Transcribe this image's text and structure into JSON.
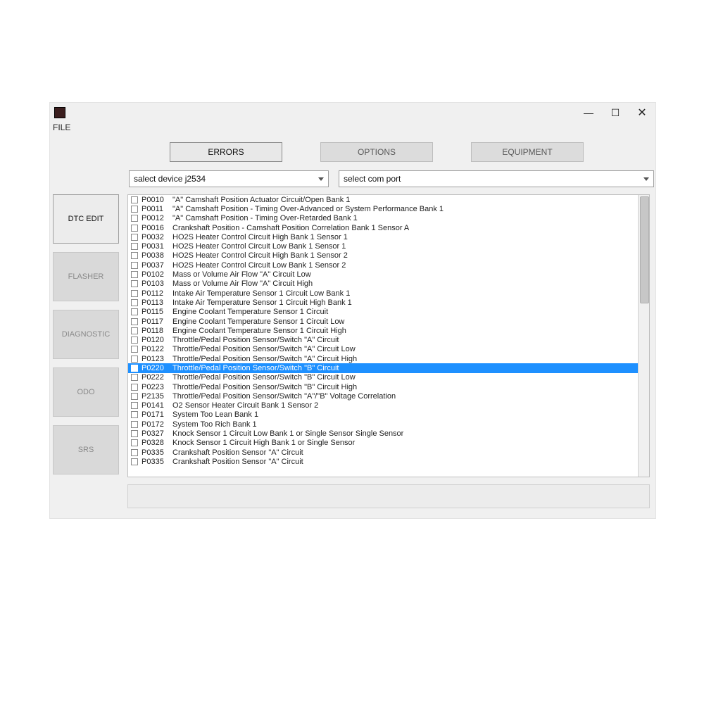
{
  "menu": {
    "file": "FILE"
  },
  "topTabs": {
    "errors": "ERRORS",
    "options": "OPTIONS",
    "equipment": "EQUIPMENT"
  },
  "activeTopTab": "errors",
  "combos": {
    "device": "salect device j2534",
    "comport": "select com port"
  },
  "sideTabs": {
    "dtc": "DTC EDIT",
    "flasher": "FLASHER",
    "diagnostic": "DIAGNOSTIC",
    "odo": "ODO",
    "srs": "SRS"
  },
  "activeSideTab": "dtc",
  "selectedIndex": 18,
  "dtcList": [
    {
      "code": "P0010",
      "desc": "\"A\" Camshaft Position Actuator Circuit/Open Bank 1"
    },
    {
      "code": "P0011",
      "desc": "\"A\" Camshaft Position - Timing Over-Advanced or System Performance Bank 1"
    },
    {
      "code": "P0012",
      "desc": "\"A\" Camshaft Position - Timing Over-Retarded Bank 1"
    },
    {
      "code": "P0016",
      "desc": "Crankshaft Position - Camshaft Position Correlation Bank 1 Sensor A"
    },
    {
      "code": "P0032",
      "desc": "HO2S Heater Control Circuit High Bank 1 Sensor 1"
    },
    {
      "code": "P0031",
      "desc": "HO2S Heater Control Circuit Low Bank 1 Sensor 1"
    },
    {
      "code": "P0038",
      "desc": "HO2S Heater Control Circuit High Bank 1 Sensor 2"
    },
    {
      "code": "P0037",
      "desc": "HO2S Heater Control Circuit Low Bank 1 Sensor 2"
    },
    {
      "code": "P0102",
      "desc": "Mass or Volume Air Flow \"A\" Circuit Low"
    },
    {
      "code": "P0103",
      "desc": "Mass or Volume Air Flow \"A\" Circuit High"
    },
    {
      "code": "P0112",
      "desc": "Intake Air Temperature Sensor 1 Circuit Low Bank 1"
    },
    {
      "code": "P0113",
      "desc": "Intake Air Temperature Sensor 1 Circuit High Bank 1"
    },
    {
      "code": "P0115",
      "desc": "Engine Coolant Temperature Sensor 1 Circuit"
    },
    {
      "code": "P0117",
      "desc": "Engine Coolant Temperature Sensor 1 Circuit Low"
    },
    {
      "code": "P0118",
      "desc": "Engine Coolant Temperature Sensor 1 Circuit High"
    },
    {
      "code": "P0120",
      "desc": "Throttle/Pedal Position Sensor/Switch \"A\" Circuit"
    },
    {
      "code": "P0122",
      "desc": "Throttle/Pedal Position Sensor/Switch \"A\" Circuit Low"
    },
    {
      "code": "P0123",
      "desc": "Throttle/Pedal Position Sensor/Switch \"A\" Circuit High"
    },
    {
      "code": "P0220",
      "desc": "Throttle/Pedal Position Sensor/Switch \"B\" Circuit"
    },
    {
      "code": "P0222",
      "desc": "Throttle/Pedal Position Sensor/Switch \"B\" Circuit Low"
    },
    {
      "code": "P0223",
      "desc": "Throttle/Pedal Position Sensor/Switch \"B\" Circuit High"
    },
    {
      "code": "P2135",
      "desc": "Throttle/Pedal Position Sensor/Switch \"A\"/\"B\" Voltage Correlation"
    },
    {
      "code": "P0141",
      "desc": "O2 Sensor Heater Circuit Bank 1 Sensor 2"
    },
    {
      "code": "P0171",
      "desc": "System Too Lean Bank 1"
    },
    {
      "code": "P0172",
      "desc": "System Too Rich Bank 1"
    },
    {
      "code": "P0327",
      "desc": "Knock Sensor 1 Circuit Low Bank 1 or Single Sensor Single Sensor"
    },
    {
      "code": "P0328",
      "desc": "Knock Sensor 1 Circuit High Bank 1 or Single Sensor"
    },
    {
      "code": "P0335",
      "desc": "Crankshaft Position Sensor \"A\" Circuit"
    },
    {
      "code": "P0335",
      "desc": "Crankshaft Position Sensor \"A\" Circuit"
    }
  ]
}
